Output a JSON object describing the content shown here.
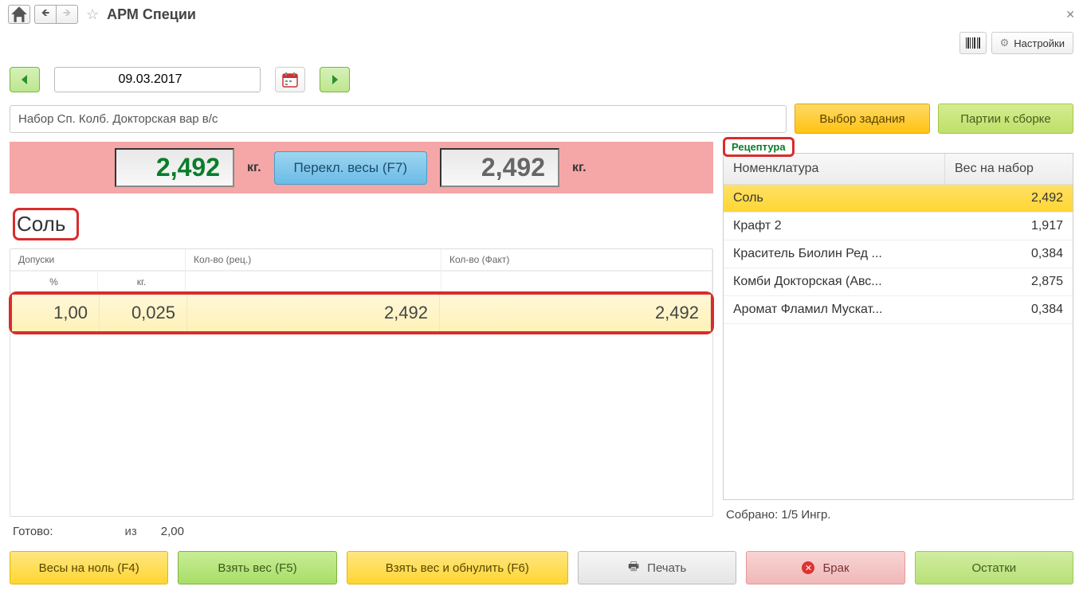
{
  "titlebar": {
    "title": "АРМ Специи"
  },
  "toolbar": {
    "settings": "Настройки"
  },
  "date_nav": {
    "date": "09.03.2017"
  },
  "task": {
    "field": "Набор Сп. Колб. Докторская вар в/с",
    "choose_btn": "Выбор задания",
    "parties_btn": "Партии к сборке"
  },
  "weight": {
    "left": "2,492",
    "right": "2,492",
    "kg": "кг.",
    "switch_btn": "Перекл. весы (F7)"
  },
  "ingredient": {
    "name": "Соль"
  },
  "tolerance": {
    "headers": {
      "allow": "Допуски",
      "qty_recipe": "Кол-во (рец.)",
      "qty_fact": "Кол-во (Факт)",
      "percent": "%",
      "kg": "кг."
    },
    "row": {
      "percent": "1,00",
      "kg": "0,025",
      "recipe": "2,492",
      "fact": "2,492"
    }
  },
  "ready": {
    "label": "Готово:",
    "iz": "из",
    "total": "2,00"
  },
  "recipe": {
    "tab": "Рецептура",
    "headers": {
      "name": "Номенклатура",
      "weight": "Вес на набор"
    },
    "rows": [
      {
        "name": "Соль",
        "weight": "2,492",
        "selected": true
      },
      {
        "name": "Крафт 2",
        "weight": "1,917"
      },
      {
        "name": "Краситель Биолин Ред ...",
        "weight": "0,384"
      },
      {
        "name": "Комби Докторская (Авс...",
        "weight": "2,875"
      },
      {
        "name": "Аромат Фламил Мускат...",
        "weight": "0,384"
      }
    ]
  },
  "collected": {
    "text": "Собрано: 1/5 Ингр."
  },
  "bottom": {
    "zero": "Весы на ноль (F4)",
    "take": "Взять вес (F5)",
    "take_zero": "Взять вес и обнулить (F6)",
    "print": "Печать",
    "defect": "Брак",
    "remains": "Остатки"
  }
}
